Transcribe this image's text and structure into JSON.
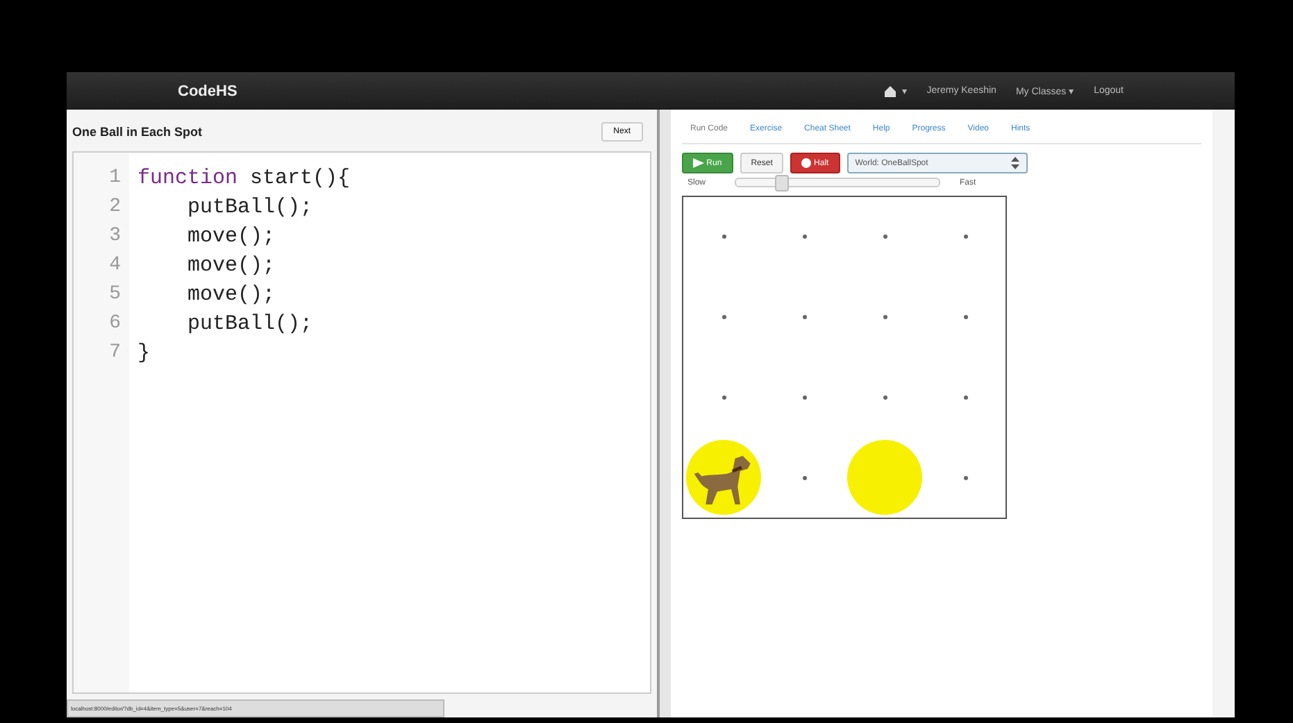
{
  "navbar": {
    "brand": "CodeHS",
    "user_menu_caret": "▾",
    "user": "Jeremy Keeshin",
    "classes": "My Classes",
    "classes_caret": "▾",
    "logout": "Logout"
  },
  "editor": {
    "title": "One Ball in Each Spot",
    "next_button": "Next",
    "lines": [
      {
        "number": "1",
        "tokens": [
          {
            "text": "function",
            "kind": "keyword"
          },
          {
            "text": " start(){",
            "kind": "plain"
          }
        ]
      },
      {
        "number": "2",
        "tokens": [
          {
            "text": "    putBall();",
            "kind": "plain"
          }
        ]
      },
      {
        "number": "3",
        "tokens": [
          {
            "text": "    move();",
            "kind": "plain"
          }
        ]
      },
      {
        "number": "4",
        "tokens": [
          {
            "text": "    move();",
            "kind": "plain"
          }
        ]
      },
      {
        "number": "5",
        "tokens": [
          {
            "text": "    move();",
            "kind": "plain"
          }
        ]
      },
      {
        "number": "6",
        "tokens": [
          {
            "text": "    putBall();",
            "kind": "plain"
          }
        ]
      },
      {
        "number": "7",
        "tokens": [
          {
            "text": "}",
            "kind": "plain"
          }
        ]
      }
    ]
  },
  "tabs": [
    {
      "label": "Run Code",
      "selected": true
    },
    {
      "label": "Exercise",
      "selected": false
    },
    {
      "label": "Cheat Sheet",
      "selected": false
    },
    {
      "label": "Help",
      "selected": false
    },
    {
      "label": "Progress",
      "selected": false
    },
    {
      "label": "Video",
      "selected": false
    },
    {
      "label": "Hints",
      "selected": false
    }
  ],
  "controls": {
    "run": "Run",
    "reset": "Reset",
    "halt": "Halt",
    "world_select": "World: OneBallSpot",
    "slow": "Slow",
    "fast": "Fast",
    "speed": {
      "level": 0.22
    }
  },
  "world": {
    "rows": [
      [
        {
          "ball": false,
          "dog": false
        },
        {
          "ball": false,
          "dog": false
        },
        {
          "ball": false,
          "dog": false
        },
        {
          "ball": false,
          "dog": false
        }
      ],
      [
        {
          "ball": false,
          "dog": false
        },
        {
          "ball": false,
          "dog": false
        },
        {
          "ball": false,
          "dog": false
        },
        {
          "ball": false,
          "dog": false
        }
      ],
      [
        {
          "ball": false,
          "dog": false
        },
        {
          "ball": false,
          "dog": false
        },
        {
          "ball": false,
          "dog": false
        },
        {
          "ball": false,
          "dog": false
        }
      ],
      [
        {
          "ball": true,
          "dog": true
        },
        {
          "ball": false,
          "dog": false
        },
        {
          "ball": true,
          "dog": false
        },
        {
          "ball": false,
          "dog": false
        }
      ]
    ]
  },
  "status_bar": {
    "url": "localhost:8000/editor/?db_id=4&item_type=5&user=7&reach=104"
  }
}
